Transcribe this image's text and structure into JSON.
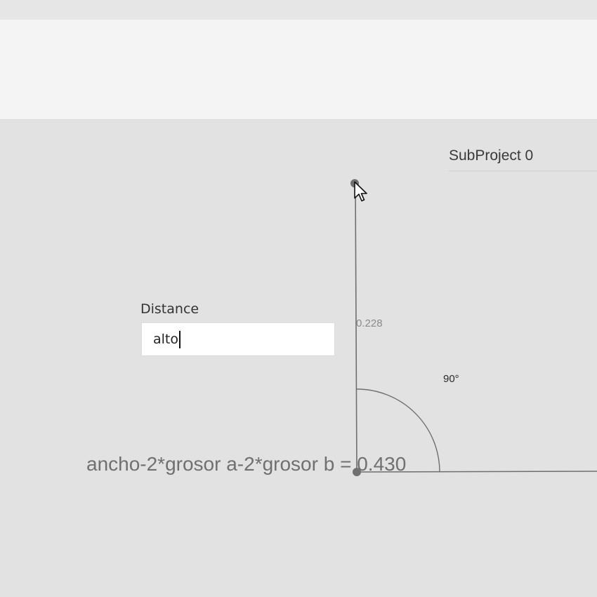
{
  "project": {
    "title": "SubProject 0"
  },
  "distance": {
    "label": "Distance",
    "value": "alto"
  },
  "drawing": {
    "dimension_value": "0.228",
    "angle_label": "90°",
    "formula": "ancho-2*grosor a-2*grosor b = 0.430"
  },
  "icons": {
    "cursor": "mouse-pointer-icon"
  },
  "colors": {
    "canvas_bg": "#e2e2e2",
    "header_bg": "#f4f4f4",
    "line": "#6f6f6f",
    "point": "#707070"
  }
}
